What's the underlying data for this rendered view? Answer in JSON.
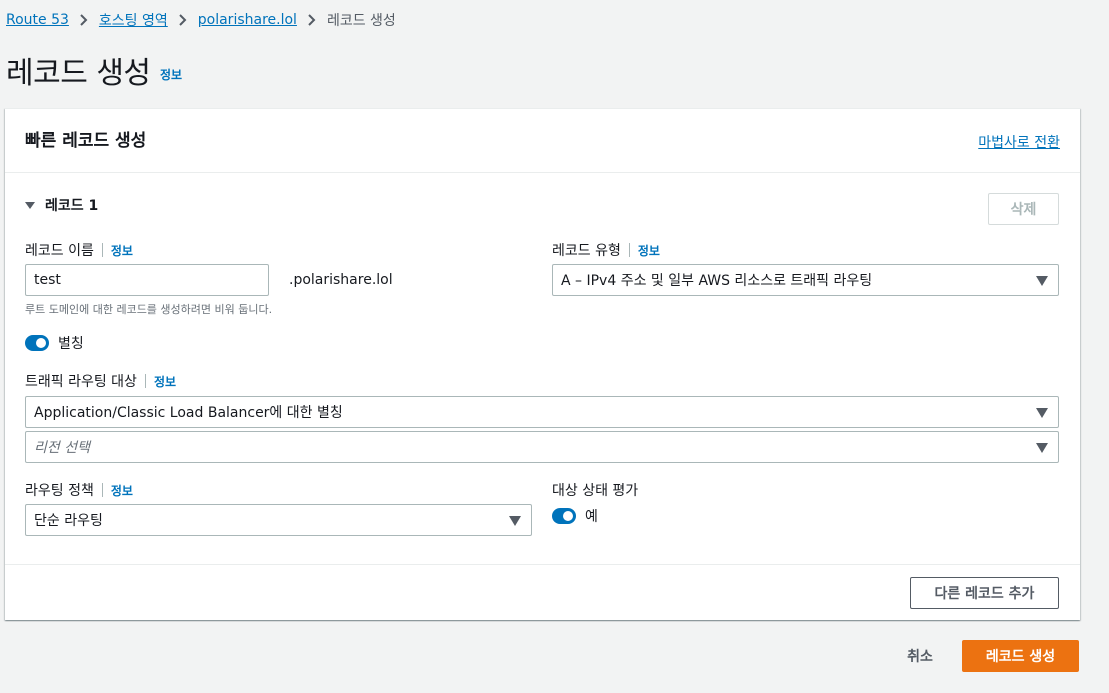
{
  "breadcrumb": {
    "items": [
      "Route 53",
      "호스팅 영역",
      "polarishare.lol"
    ],
    "current": "레코드 생성"
  },
  "page": {
    "title": "레코드 생성",
    "info": "정보"
  },
  "panel": {
    "title": "빠른 레코드 생성",
    "wizard_link": "마법사로 전환",
    "record_title": "레코드 1",
    "delete_label": "삭제",
    "record_name": {
      "label": "레코드 이름",
      "info": "정보",
      "value": "test",
      "suffix": ".polarishare.lol",
      "hint": "루트 도메인에 대한 레코드를 생성하려면 비워 둡니다."
    },
    "record_type": {
      "label": "레코드 유형",
      "info": "정보",
      "value": "A – IPv4 주소 및 일부 AWS 리소스로 트래픽 라우팅"
    },
    "alias": {
      "label": "별칭",
      "enabled": true
    },
    "route_target": {
      "label": "트래픽 라우팅 대상",
      "info": "정보",
      "value": "Application/Classic Load Balancer에 대한 별칭",
      "region_placeholder": "리전 선택"
    },
    "routing_policy": {
      "label": "라우팅 정책",
      "info": "정보",
      "value": "단순 라우팅"
    },
    "health": {
      "label": "대상 상태 평가",
      "value": "예",
      "enabled": true
    },
    "add_record_label": "다른 레코드 추가"
  },
  "actions": {
    "cancel": "취소",
    "create": "레코드 생성"
  },
  "colors": {
    "link": "#0073bb",
    "primary": "#ec7211",
    "toggle": "#0073bb"
  }
}
